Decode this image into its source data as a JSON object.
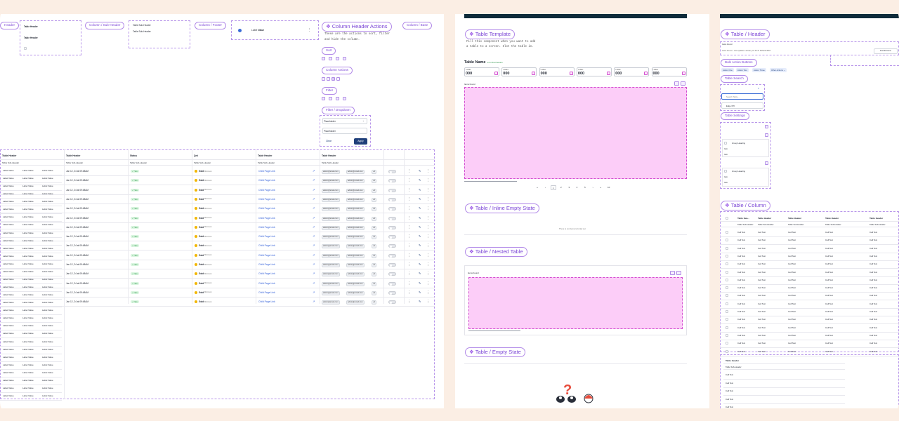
{
  "labels": {
    "header": "Header",
    "col_subheader": "Column / Sub-Header",
    "col_footer": "Column / Footer",
    "col_base": "Column / Base",
    "col_header_actions": "Column Header Actions",
    "sort": "Sort",
    "column_actions": "Column Actions",
    "filter": "Filter",
    "filter_dropdown": "Filter / Dropdown",
    "table_template": "Table Template",
    "table_header": "Table / Header",
    "bulk_action_buttons": "Bulk Action Buttons",
    "table_search": "Table Search",
    "table_settings": "Table Settings",
    "inline_empty": "Table / Inline Empty State",
    "nested": "Table / Nested Table",
    "empty_state": "Table / Empty State",
    "table_column": "Table / Column"
  },
  "actions_desc": [
    "These are the actions to sort, filter",
    "and hide the column."
  ],
  "template_desc": [
    "Fill this component when you want to add",
    "a table to a screen. Slot the table in."
  ],
  "mini": {
    "table_header": "Table Header",
    "table_sub_header": "Table Sub-Header",
    "label": "Label",
    "value": "Value"
  },
  "filter_dd": {
    "placeholder": "Placeholder",
    "clear": "Clear",
    "apply": "Apply"
  },
  "template": {
    "table_name": "Table Name",
    "status": "● In Prod Version",
    "stat_label": "LABEL",
    "stat_value": "000",
    "items_found": "Items Found"
  },
  "pagination": [
    "«",
    "‹",
    "1",
    "2",
    "3",
    "4",
    "5",
    "›",
    "»",
    "10"
  ],
  "header_panel": {
    "items_found": "Items Found",
    "updated": "Items Found · Last updated: January 21 03:47 PM EST/EDT",
    "records": "Find 20 Items",
    "bulk": [
      "Action One",
      "Action Two",
      "Action Three",
      "Other Actions ⌄"
    ],
    "search_placeholder": "Search Table...",
    "edge": "Edge 370",
    "group_heading": "Group Heading",
    "item": "Item"
  },
  "empty_inline": "There is no [Item] currently set",
  "main_table": {
    "headers": [
      "Table Header",
      "Table Header",
      "Status",
      "Qnt",
      "Table Header",
      "Table Header"
    ],
    "sub": "Table Sub-Header",
    "date": "Jan 12, 24 at 09:48AM",
    "status": "Yes",
    "qnt_label": "Gold",
    "qnt_sub": "Minimum",
    "link": "Child Page Link",
    "email1": "admin@email.com",
    "email2": "admin@email.com",
    "extra": "+3"
  },
  "right_table": {
    "headers": [
      "Table Hea...",
      "Table Header",
      "Table Header",
      "Table Header",
      "Table Header"
    ],
    "sub": "Table Sub-Header",
    "cell": "Cell Text",
    "footer_header": "Table Header",
    "footer_sub": "Table Sub-Header"
  },
  "colors": {
    "accent": "#7a44d6",
    "pink": "#fccdf8",
    "dark": "#0f2b3a",
    "primary": "#1f3f7a"
  }
}
